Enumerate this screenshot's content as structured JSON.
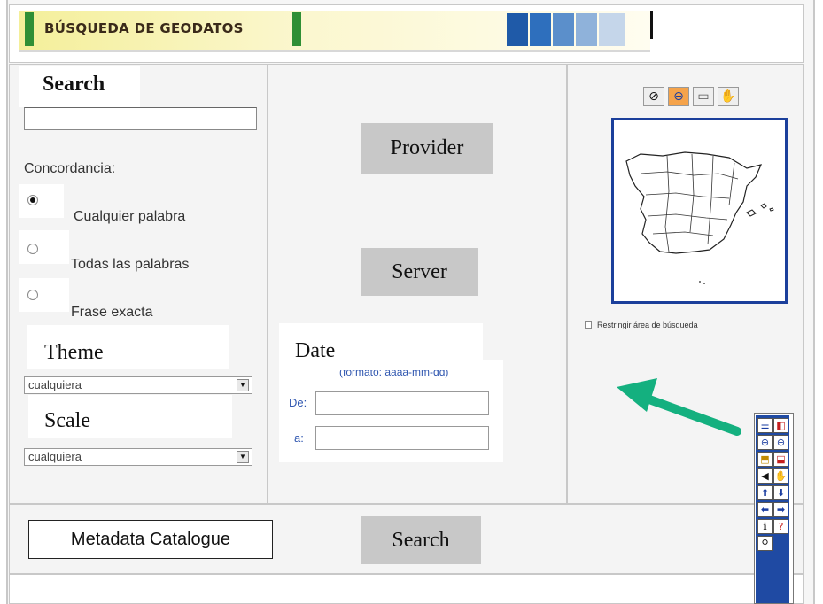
{
  "banner": {
    "title": "BÚSQUEDA DE GEODATOS",
    "squares": [
      "#1f5aa8",
      "#2e6fbd",
      "#5b8fcb",
      "#8fb2da",
      "#c5d6ea"
    ]
  },
  "search_panel": {
    "caption": "Search",
    "search_value": "",
    "concordance_label": "Concordancia:",
    "options": [
      {
        "label": "Cualquier palabra",
        "selected": true
      },
      {
        "label": "Todas las palabras",
        "selected": false
      },
      {
        "label": "Frase exacta",
        "selected": false
      }
    ],
    "theme_caption": "Theme",
    "theme_select": "cualquiera",
    "scale_caption": "Scale",
    "scale_select": "cualquiera"
  },
  "middle_panel": {
    "provider_label": "Provider",
    "server_label": "Server",
    "date_caption": "Date",
    "date_format": "(formato: aaaa-mm-dd)",
    "from_label": "De:",
    "to_label": "a:",
    "from_value": "",
    "to_value": ""
  },
  "map_panel": {
    "tools": [
      "no-entry-icon",
      "zoom-out-icon",
      "select-area-icon",
      "pan-hand-icon"
    ],
    "restrict_label": "Restringir área de búsqueda",
    "restrict_checked": false,
    "frame_color": "#1b3f9b"
  },
  "bottom": {
    "catalogue_label": "Metadata Catalogue",
    "search_label": "Search"
  },
  "annotation": {
    "arrow_color": "#14b07f"
  }
}
